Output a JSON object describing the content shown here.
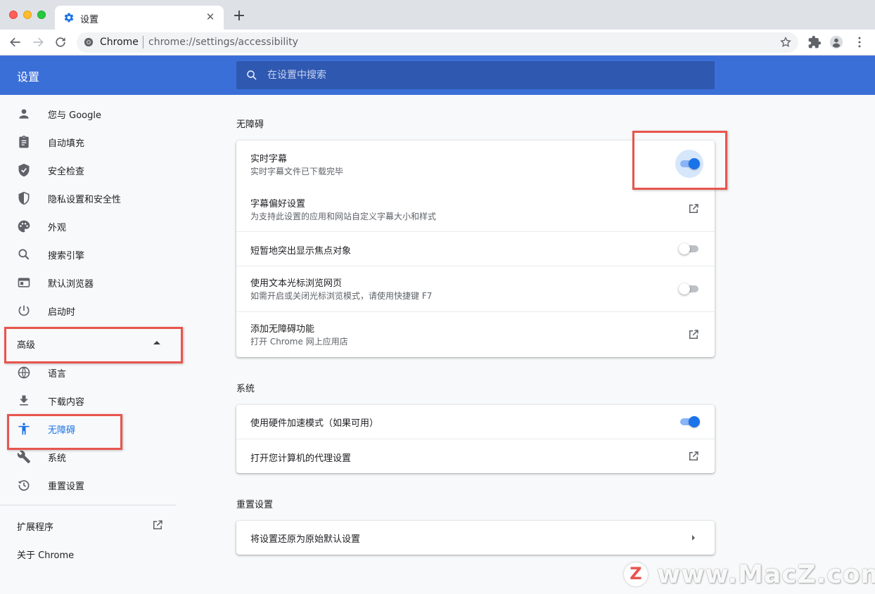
{
  "browser": {
    "tab_title": "设置",
    "omnibox_site": "Chrome",
    "omnibox_url": "chrome://settings/accessibility"
  },
  "header": {
    "title": "设置",
    "search_placeholder": "在设置中搜索"
  },
  "sidebar": {
    "items": [
      {
        "label": "您与 Google",
        "icon": "person-icon"
      },
      {
        "label": "自动填充",
        "icon": "clipboard-icon"
      },
      {
        "label": "安全检查",
        "icon": "shield-check-icon"
      },
      {
        "label": "隐私设置和安全性",
        "icon": "shield-half-icon"
      },
      {
        "label": "外观",
        "icon": "palette-icon"
      },
      {
        "label": "搜索引擎",
        "icon": "search-icon"
      },
      {
        "label": "默认浏览器",
        "icon": "browser-window-icon"
      },
      {
        "label": "启动时",
        "icon": "power-icon"
      }
    ],
    "advanced_label": "高级",
    "advanced_items": [
      {
        "label": "语言",
        "icon": "globe-icon"
      },
      {
        "label": "下载内容",
        "icon": "download-icon"
      },
      {
        "label": "无障碍",
        "icon": "accessibility-icon",
        "active": true
      },
      {
        "label": "系统",
        "icon": "wrench-icon"
      },
      {
        "label": "重置设置",
        "icon": "history-icon"
      }
    ],
    "extensions_label": "扩展程序",
    "about_label": "关于 Chrome"
  },
  "main": {
    "accessibility": {
      "title": "无障碍",
      "live_caption": {
        "label": "实时字幕",
        "sub": "实时字幕文件已下载完毕",
        "enabled": true
      },
      "caption_prefs": {
        "label": "字幕偏好设置",
        "sub": "为支持此设置的应用和网站自定义字幕大小和样式"
      },
      "focus_highlight": {
        "label": "短暂地突出显示焦点对象",
        "enabled": false
      },
      "caret_browsing": {
        "label": "使用文本光标浏览网页",
        "sub": "如需开启或关闭光标浏览模式，请使用快捷键 F7",
        "enabled": false
      },
      "add_features": {
        "label": "添加无障碍功能",
        "sub": "打开 Chrome 网上应用店"
      }
    },
    "system": {
      "title": "系统",
      "hw_accel": {
        "label": "使用硬件加速模式（如果可用）",
        "enabled": true
      },
      "proxy": {
        "label": "打开您计算机的代理设置"
      }
    },
    "reset": {
      "title": "重置设置",
      "restore": {
        "label": "将设置还原为原始默认设置"
      }
    }
  },
  "watermark": {
    "badge": "Z",
    "text": "www.MacZ.com"
  },
  "colors": {
    "accent": "#1a73e8",
    "header": "#3b6fd8",
    "highlight_box": "#e8554e"
  }
}
